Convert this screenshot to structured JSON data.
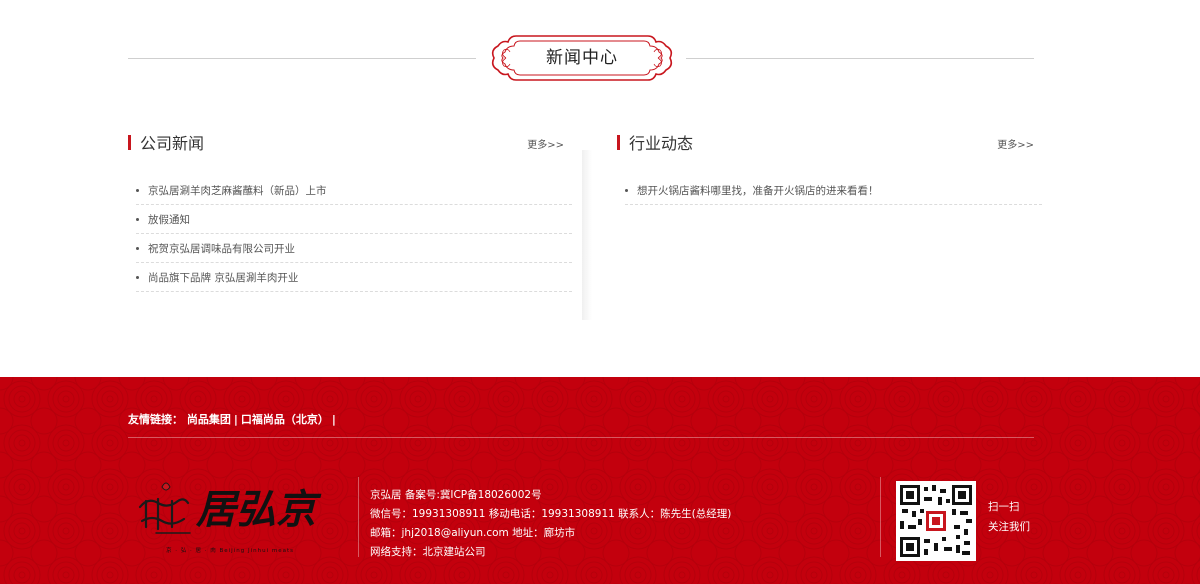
{
  "section": {
    "title": "新闻中心"
  },
  "company_news": {
    "title": "公司新闻",
    "more": "更多>>",
    "items": [
      "京弘居涮羊肉芝麻酱蘸料（新品）上市",
      "放假通知",
      "祝贺京弘居调味品有限公司开业",
      "尚品旗下品牌 京弘居涮羊肉开业"
    ]
  },
  "industry_news": {
    "title": "行业动态",
    "more": "更多>>",
    "items": [
      "想开火锅店酱料哪里找，准备开火锅店的进来看看！"
    ]
  },
  "footer": {
    "friend_label": "友情链接：",
    "friend_links": [
      "尚品集团",
      "口福尚品（北京）"
    ],
    "logo_text": "居弘京",
    "logo_sub": "京 · 弘 · 居 · 肉  Beijing Jinhui meats",
    "info": {
      "line1": "京弘居  备案号:冀ICP备18026002号",
      "line2": "微信号：19931308911  移动电话：19931308911      联系人：陈先生(总经理)",
      "line3": "邮箱：jhj2018@aliyun.com   地址：廊坊市",
      "line4": "网络支持：北京建站公司"
    },
    "qr_caption": [
      "扫一扫",
      "关注我们"
    ],
    "colors": {
      "footer_bg": "#c3000d",
      "accent": "#c8161e"
    }
  }
}
